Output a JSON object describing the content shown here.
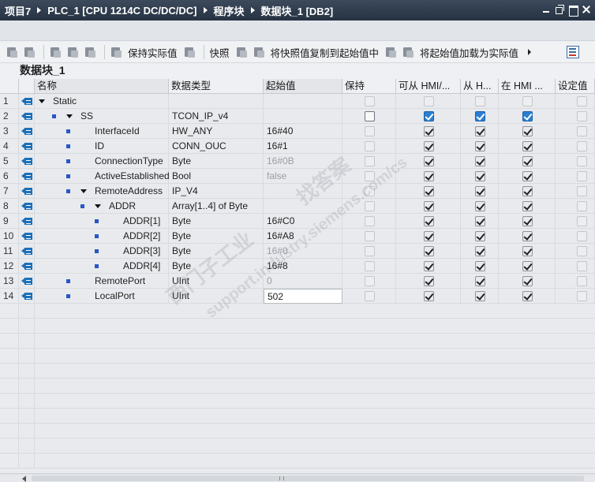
{
  "breadcrumb": [
    "项目7",
    "PLC_1 [CPU 1214C DC/DC/DC]",
    "程序块",
    "数据块_1 [DB2]"
  ],
  "toolbar": {
    "keep_actual": "保持实际值",
    "snapshot": "快照",
    "copy_snapshot": "将快照值复制到起始值中",
    "load_start": "将起始值加载为实际值"
  },
  "block_title": "数据块_1",
  "columns": [
    "名称",
    "数据类型",
    "起始值",
    "保持",
    "可从 HMI/...",
    "从 H...",
    "在 HMI ...",
    "设定值"
  ],
  "rows": [
    {
      "num": "1",
      "name": "Static",
      "type": "",
      "start": "",
      "start_style": "normal",
      "level": 0,
      "expander": "open",
      "show_dot": false,
      "retain": "disabled",
      "hmi_access": "disabled",
      "hmi_write": "disabled",
      "hmi_visible": "disabled",
      "setpoint": "disabled"
    },
    {
      "num": "2",
      "name": "SS",
      "type": "TCON_IP_v4",
      "start": "",
      "start_style": "normal",
      "level": 1,
      "expander": "open",
      "show_dot": true,
      "retain": "active",
      "hmi_access": "blue",
      "hmi_write": "blue",
      "hmi_visible": "blue",
      "setpoint": "disabled"
    },
    {
      "num": "3",
      "name": "InterfaceId",
      "type": "HW_ANY",
      "start": "16#40",
      "start_style": "normal",
      "level": 2,
      "expander": "none",
      "show_dot": true,
      "retain": "disabled",
      "hmi_access": "checked",
      "hmi_write": "checked",
      "hmi_visible": "checked",
      "setpoint": "disabled"
    },
    {
      "num": "4",
      "name": "ID",
      "type": "CONN_OUC",
      "start": "16#1",
      "start_style": "normal",
      "level": 2,
      "expander": "none",
      "show_dot": true,
      "retain": "disabled",
      "hmi_access": "checked",
      "hmi_write": "checked",
      "hmi_visible": "checked",
      "setpoint": "disabled"
    },
    {
      "num": "5",
      "name": "ConnectionType",
      "type": "Byte",
      "start": "16#0B",
      "start_style": "gray",
      "level": 2,
      "expander": "none",
      "show_dot": true,
      "retain": "disabled",
      "hmi_access": "checked",
      "hmi_write": "checked",
      "hmi_visible": "checked",
      "setpoint": "disabled"
    },
    {
      "num": "6",
      "name": "ActiveEstablished",
      "type": "Bool",
      "start": "false",
      "start_style": "gray",
      "level": 2,
      "expander": "none",
      "show_dot": true,
      "retain": "disabled",
      "hmi_access": "checked",
      "hmi_write": "checked",
      "hmi_visible": "checked",
      "setpoint": "disabled"
    },
    {
      "num": "7",
      "name": "RemoteAddress",
      "type": "IP_V4",
      "start": "",
      "start_style": "normal",
      "level": 2,
      "expander": "open",
      "show_dot": true,
      "retain": "disabled",
      "hmi_access": "checked",
      "hmi_write": "checked",
      "hmi_visible": "checked",
      "setpoint": "disabled"
    },
    {
      "num": "8",
      "name": "ADDR",
      "type": "Array[1..4] of Byte",
      "start": "",
      "start_style": "normal",
      "level": 3,
      "expander": "open",
      "show_dot": true,
      "retain": "disabled",
      "hmi_access": "checked",
      "hmi_write": "checked",
      "hmi_visible": "checked",
      "setpoint": "disabled"
    },
    {
      "num": "9",
      "name": "ADDR[1]",
      "type": "Byte",
      "start": "16#C0",
      "start_style": "normal",
      "level": 4,
      "expander": "none",
      "show_dot": true,
      "retain": "disabled",
      "hmi_access": "checked",
      "hmi_write": "checked",
      "hmi_visible": "checked",
      "setpoint": "disabled"
    },
    {
      "num": "10",
      "name": "ADDR[2]",
      "type": "Byte",
      "start": "16#A8",
      "start_style": "normal",
      "level": 4,
      "expander": "none",
      "show_dot": true,
      "retain": "disabled",
      "hmi_access": "checked",
      "hmi_write": "checked",
      "hmi_visible": "checked",
      "setpoint": "disabled"
    },
    {
      "num": "11",
      "name": "ADDR[3]",
      "type": "Byte",
      "start": "16#0",
      "start_style": "gray",
      "level": 4,
      "expander": "none",
      "show_dot": true,
      "retain": "disabled",
      "hmi_access": "checked",
      "hmi_write": "checked",
      "hmi_visible": "checked",
      "setpoint": "disabled"
    },
    {
      "num": "12",
      "name": "ADDR[4]",
      "type": "Byte",
      "start": "16#8",
      "start_style": "normal",
      "level": 4,
      "expander": "none",
      "show_dot": true,
      "retain": "disabled",
      "hmi_access": "checked",
      "hmi_write": "checked",
      "hmi_visible": "checked",
      "setpoint": "disabled"
    },
    {
      "num": "13",
      "name": "RemotePort",
      "type": "UInt",
      "start": "0",
      "start_style": "gray",
      "level": 2,
      "expander": "none",
      "show_dot": true,
      "retain": "disabled",
      "hmi_access": "checked",
      "hmi_write": "checked",
      "hmi_visible": "checked",
      "setpoint": "disabled"
    },
    {
      "num": "14",
      "name": "LocalPort",
      "type": "UInt",
      "start": "502",
      "start_style": "edited",
      "level": 2,
      "expander": "none",
      "show_dot": true,
      "retain": "disabled",
      "hmi_access": "checked",
      "hmi_write": "checked",
      "hmi_visible": "checked",
      "setpoint": "disabled"
    }
  ],
  "watermarks": [
    "找答案",
    "西门子工业",
    "support.industry.siemens.com/cs"
  ],
  "icons": {
    "interface": "db-interface-icon",
    "expand": "expand-triangle-icon",
    "element": "element-square-icon"
  },
  "colors": {
    "title_bar": "#253242",
    "interface_icon": "#1d70b8",
    "element_dot": "#2856c8",
    "checkbox_blue": "#2a7fd4"
  }
}
